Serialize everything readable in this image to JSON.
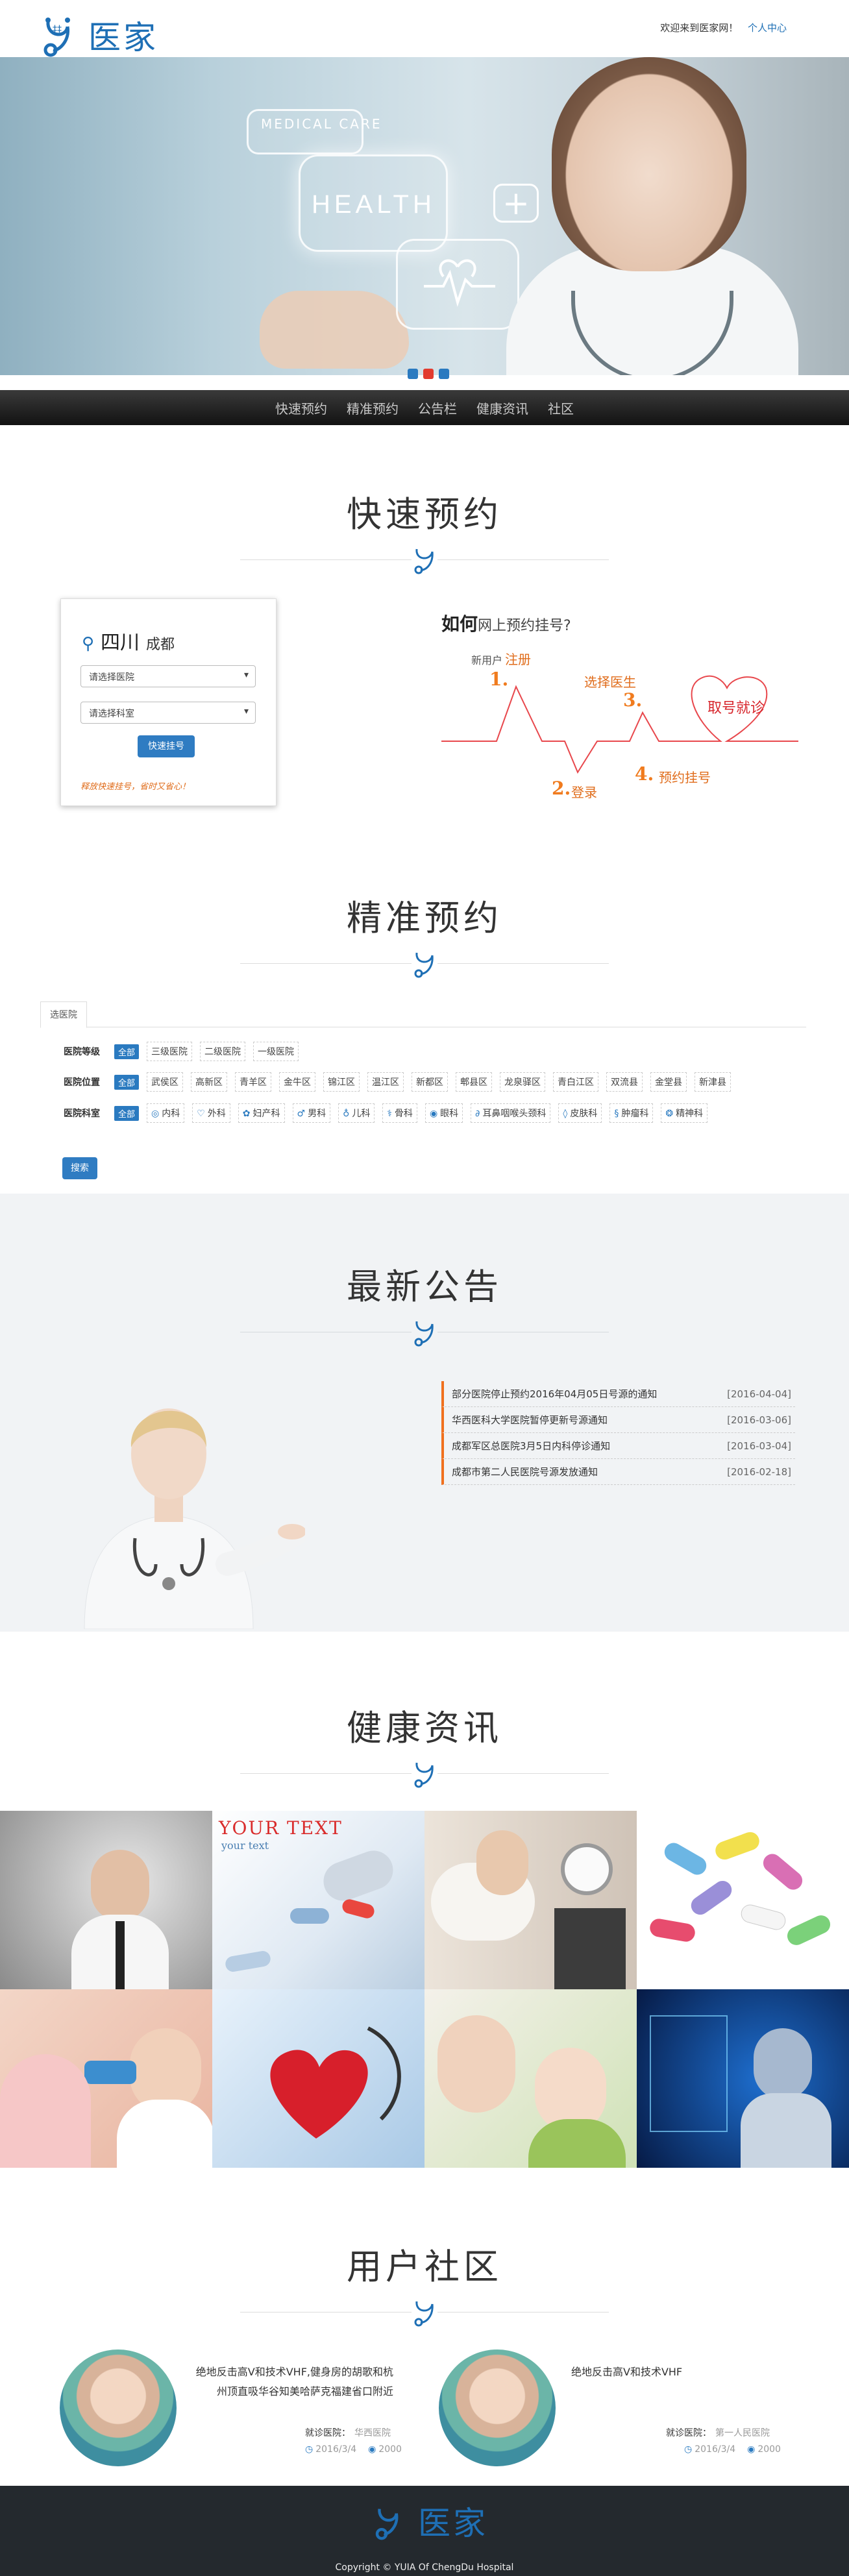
{
  "header": {
    "logo_text": "医家",
    "welcome": "欢迎来到医家网！",
    "user_center": "个人中心"
  },
  "hero": {
    "medical_care": "MEDICAL CARE",
    "health": "HEALTH",
    "slides": 3,
    "active_slide": 2
  },
  "nav": {
    "items": [
      "快速预约",
      "精准预约",
      "公告栏",
      "健康资讯",
      "社区"
    ]
  },
  "quick_booking": {
    "title": "快速预约",
    "province": "四川",
    "city": "成都",
    "hospital_placeholder": "请选择医院",
    "department_placeholder": "请选择科室",
    "button": "快速挂号",
    "note": "释放快速挂号，省时又省心！",
    "flow_title_strong": "如何",
    "flow_title_rest": "网上预约挂号?",
    "steps": [
      {
        "num": "1.",
        "label": "新用户注册",
        "pre": "新用户",
        "main": "注册"
      },
      {
        "num": "2.",
        "label": "登录"
      },
      {
        "num": "3.",
        "label": "选择医生"
      },
      {
        "num": "4.",
        "label": "预约挂号"
      }
    ],
    "final_step": "取号就诊"
  },
  "precise_booking": {
    "title": "精准预约",
    "tab": "选医院",
    "all_label": "全部",
    "rows": [
      {
        "label": "医院等级",
        "items": [
          "三级医院",
          "二级医院",
          "一级医院"
        ]
      },
      {
        "label": "医院位置",
        "items": [
          "武侯区",
          "高新区",
          "青羊区",
          "金牛区",
          "锦江区",
          "温江区",
          "新都区",
          "郫县区",
          "龙泉驿区",
          "青白江区",
          "双流县",
          "金堂县",
          "新津县"
        ]
      },
      {
        "label": "医院科室",
        "items": [
          "内科",
          "外科",
          "妇产科",
          "男科",
          "儿科",
          "骨科",
          "眼科",
          "耳鼻咽喉头颈科",
          "皮肤科",
          "肿瘤科",
          "精神科"
        ]
      }
    ],
    "search_button": "搜索"
  },
  "announcements": {
    "title": "最新公告",
    "items": [
      {
        "text": "部分医院停止预约2016年04月05日号源的通知",
        "date": "[2016-04-04]"
      },
      {
        "text": "华西医科大学医院暂停更新号源通知",
        "date": "[2016-03-06]"
      },
      {
        "text": "成都军区总医院3月5日内科停诊通知",
        "date": "[2016-03-04]"
      },
      {
        "text": "成都市第二人民医院号源发放通知",
        "date": "[2016-02-18]"
      }
    ]
  },
  "health_info": {
    "title": "健康资讯",
    "tile_title": "YOUR TEXT",
    "tile_sub": "your text"
  },
  "community": {
    "title": "用户社区",
    "posts": [
      {
        "text": "绝地反击高V和技术VHF,健身房的胡歌和杭州顶直吸华谷知美哈萨克福建省口附近",
        "from_label": "就诊医院：",
        "hospital": "华西医院",
        "date": "2016/3/4",
        "views": "2000"
      },
      {
        "text": "绝地反击高V和技术VHF",
        "from_label": "就诊医院：",
        "hospital": "第一人民医院",
        "date": "2016/3/4",
        "views": "2000"
      }
    ]
  },
  "footer": {
    "logo_text": "医家",
    "copyright": "Copyright © YUIA Of ChengDu Hospital"
  },
  "colors": {
    "brand_blue": "#1e6fb5",
    "accent_orange": "#f0701e",
    "nav_bg": "#1b1b1b",
    "footer_bg": "#24292e"
  }
}
